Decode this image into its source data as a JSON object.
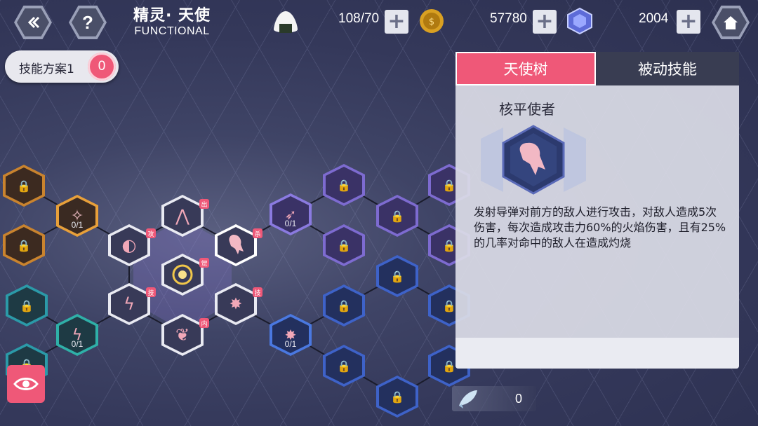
{
  "header": {
    "title_cn": "精灵· 天使",
    "title_en": "FUNCTIONAL",
    "back_icon": "back-icon",
    "help_icon": "help-icon",
    "home_icon": "home-icon"
  },
  "resources": {
    "stamina": "108/70",
    "coins": "57780",
    "gems": "2004"
  },
  "scheme": {
    "label": "技能方案1",
    "count": "0"
  },
  "panel": {
    "tabs": [
      "天使树",
      "被动技能"
    ],
    "active_tab": "天使树",
    "skill_name": "核平使者",
    "description": "发射导弹对前方的敌人进行攻击，对敌人造成5次伤害，每次造成攻击力60%的火焰伤害，且有25%的几率对命中的敌人在造成灼烧"
  },
  "tree": {
    "badges": {
      "atk": "攻",
      "out": "出",
      "kill": "杀",
      "wake": "觉",
      "skill": "技",
      "inner": "内"
    },
    "levels": {
      "lv_a": "0/1",
      "lv_b": "0/1",
      "lv_c": "0/1",
      "lv_d": "0/1"
    }
  },
  "bottom": {
    "fish_count": "0"
  },
  "colors": {
    "accent": "#ef5878",
    "panel_bg": "#dadce6",
    "node_purple": "#7d6bd0",
    "node_blue": "#3e62c8",
    "node_orange": "#c9832e",
    "node_teal": "#2b9aa8"
  }
}
